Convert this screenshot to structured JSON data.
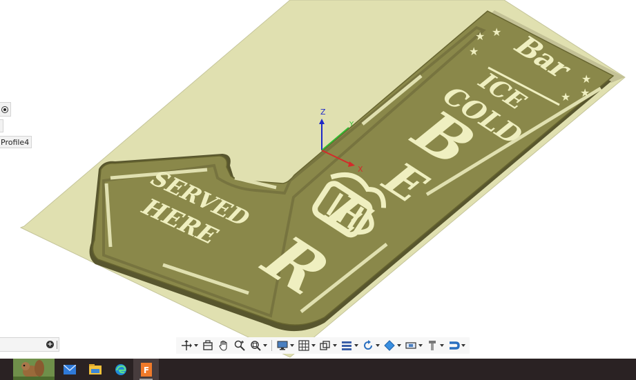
{
  "window": {
    "app": "Autodesk Fusion 360",
    "view": "isometric 3D viewport"
  },
  "browser_panel": {
    "profile_label": "Profile4"
  },
  "axes": {
    "z_label": "Z",
    "y_label": "Y",
    "x_label": "X"
  },
  "model": {
    "sign_text": {
      "top_word": "Bar",
      "line1": "ICE",
      "line2": "COLD",
      "big_letters": [
        "B",
        "E",
        "E",
        "R"
      ],
      "arrow_line1": "SERVED",
      "arrow_line2": "HERE"
    },
    "colors": {
      "plate": "#e0e0b0",
      "sign_face": "#8a884a",
      "sign_edge": "#58562e",
      "recess": "#6a6838",
      "text_fill": "#efefc0"
    }
  },
  "timeline": {
    "add_icon": "plus-circle-icon"
  },
  "nav_toolbar": {
    "tools": [
      {
        "name": "orbit-tool",
        "icon": "orbit-icon",
        "dropdown": true
      },
      {
        "name": "look-at-tool",
        "icon": "look-at-icon",
        "dropdown": false
      },
      {
        "name": "pan-tool",
        "icon": "hand-icon",
        "dropdown": false
      },
      {
        "name": "zoom-tool",
        "icon": "zoom-icon",
        "dropdown": false
      },
      {
        "name": "fit-tool",
        "icon": "zoom-window-icon",
        "dropdown": true
      },
      {
        "name": "display-settings",
        "icon": "monitor-icon",
        "dropdown": true
      },
      {
        "name": "grid-settings",
        "icon": "grid-icon",
        "dropdown": true
      },
      {
        "name": "viewports",
        "icon": "viewport-cube-icon",
        "dropdown": true
      },
      {
        "name": "effects",
        "icon": "layers-icon",
        "dropdown": true
      },
      {
        "name": "rotate-view",
        "icon": "rotate-icon",
        "dropdown": true
      },
      {
        "name": "appearance",
        "icon": "diamond-icon",
        "dropdown": true
      },
      {
        "name": "section-analysis",
        "icon": "section-icon",
        "dropdown": true
      },
      {
        "name": "measure",
        "icon": "torch-icon",
        "dropdown": true
      },
      {
        "name": "joint",
        "icon": "magnet-icon",
        "dropdown": true
      }
    ]
  },
  "taskbar": {
    "colors": {
      "bg": "#2a2223",
      "active": "#473c3d"
    },
    "apps": [
      {
        "name": "wallpaper-squirrel",
        "icon": "squirrel-icon"
      },
      {
        "name": "mail",
        "icon": "mail-icon"
      },
      {
        "name": "file-explorer",
        "icon": "folder-icon"
      },
      {
        "name": "edge",
        "icon": "edge-icon"
      },
      {
        "name": "fusion-360",
        "icon": "fusion-icon",
        "active": true
      }
    ]
  }
}
